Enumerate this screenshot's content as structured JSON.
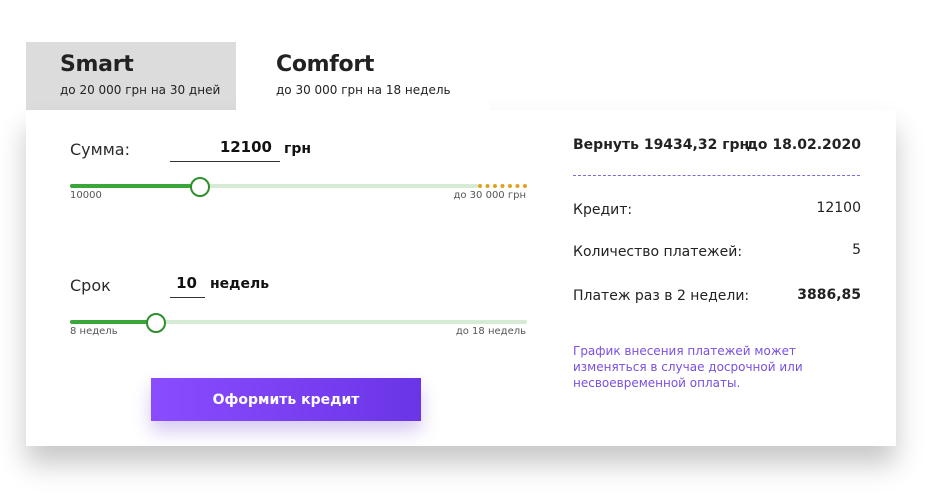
{
  "tabs": [
    {
      "title": "Smart",
      "subtitle": "до 20 000 грн на 30 дней"
    },
    {
      "title": "Comfort",
      "subtitle": "до 30 000 грн на 18 недель"
    }
  ],
  "form": {
    "amount": {
      "label": "Сумма:",
      "value": "12100",
      "unit": "грн",
      "min_label": "10000",
      "max_label": "до 30 000 грн",
      "min": 10000,
      "max": 30000,
      "current": 12100
    },
    "term": {
      "label": "Срок",
      "value": "10",
      "unit": "недель",
      "min_label": "8 недель",
      "max_label": "до 18 недель",
      "min": 8,
      "max": 18,
      "current": 10
    },
    "submit_label": "Оформить кредит"
  },
  "summary": {
    "return_label": "Вернуть 19434,32 грн",
    "return_date": "до 18.02.2020",
    "credit_label": "Кредит:",
    "credit_value": "12100",
    "payments_count_label": "Количество платежей:",
    "payments_count_value": "5",
    "payment_label": "Платеж раз в 2 недели:",
    "payment_value": "3886,85",
    "note": "График внесения платежей может изменяться в случае досрочной или несвоевременной оплаты."
  },
  "colors": {
    "accent": "#7b45f0",
    "slider_fill": "#3aa53a",
    "slider_track": "#d6ebd3",
    "slider_limit": "#e0a21b",
    "tab_inactive": "#dcdcdc"
  }
}
